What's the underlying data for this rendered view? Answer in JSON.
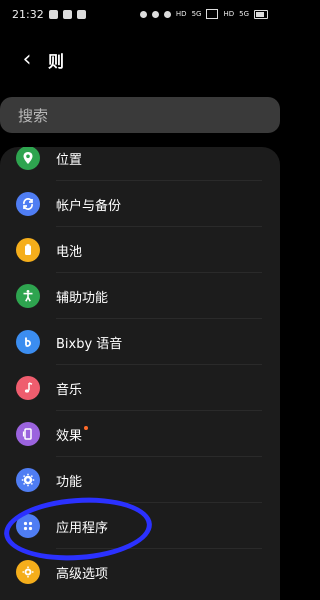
{
  "status_bar": {
    "time": "21:32",
    "labels": [
      "HD",
      "5G",
      "HD",
      "5G"
    ]
  },
  "header": {
    "back_icon": "chevron-left-icon",
    "title": "则"
  },
  "search": {
    "placeholder": "搜索"
  },
  "settings": {
    "items": [
      {
        "label": "位置",
        "icon": "location-icon",
        "color": "#2ea44f"
      },
      {
        "label": "帐户与备份",
        "icon": "sync-icon",
        "color": "#4f7df3"
      },
      {
        "label": "电池",
        "icon": "battery-icon",
        "color": "#f5ae1b"
      },
      {
        "label": "辅助功能",
        "icon": "accessibility-icon",
        "color": "#2ea44f"
      },
      {
        "label": "Bixby 语音",
        "icon": "bixby-icon",
        "color": "#3b8df0"
      },
      {
        "label": "音乐",
        "icon": "music-note-icon",
        "color": "#ef5d6e"
      },
      {
        "label": "效果",
        "icon": "effects-icon",
        "color": "#9b63de",
        "badge": true
      },
      {
        "label": "功能",
        "icon": "gear-icon",
        "color": "#4f7df3"
      },
      {
        "label": "应用程序",
        "icon": "apps-grid-icon",
        "color": "#4f7df3"
      },
      {
        "label": "高级选项",
        "icon": "advanced-settings-icon",
        "color": "#f5ae1b"
      }
    ]
  },
  "annotation": {
    "type": "circle",
    "color": "#2b31ff",
    "target": "应用程序"
  }
}
